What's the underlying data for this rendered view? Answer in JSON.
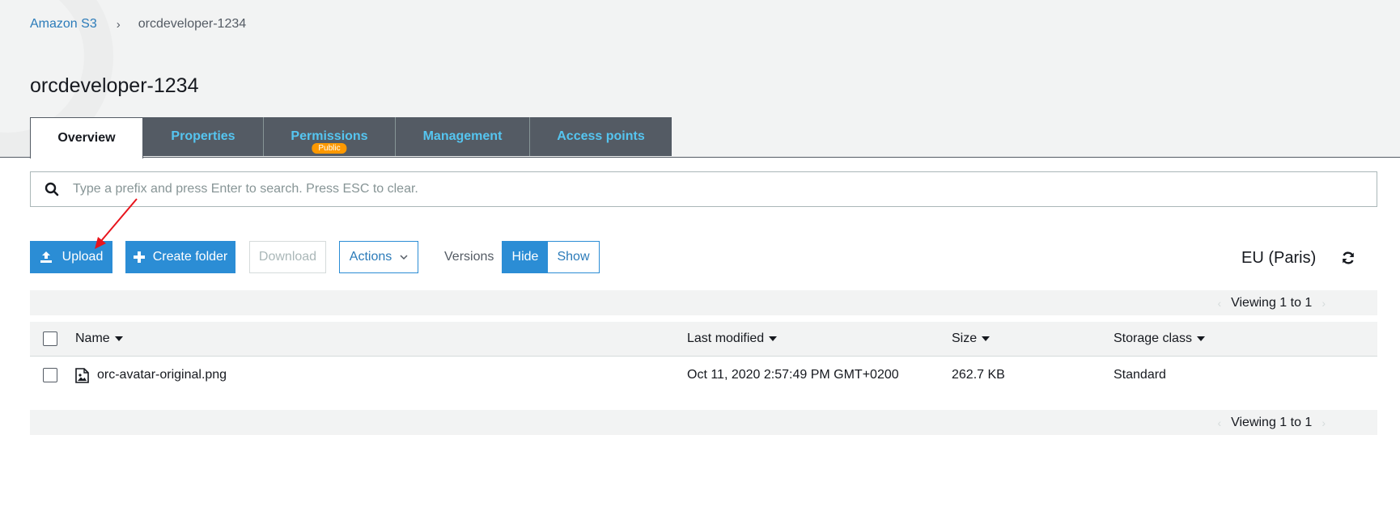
{
  "breadcrumb": {
    "root": "Amazon S3",
    "separator": "›",
    "current": "orcdeveloper-1234"
  },
  "page": {
    "title": "orcdeveloper-1234"
  },
  "tabs": [
    {
      "label": "Overview",
      "active": true
    },
    {
      "label": "Properties"
    },
    {
      "label": "Permissions",
      "badge": "Public"
    },
    {
      "label": "Management"
    },
    {
      "label": "Access points"
    }
  ],
  "search": {
    "placeholder": "Type a prefix and press Enter to search. Press ESC to clear.",
    "value": ""
  },
  "toolbar": {
    "upload": "Upload",
    "create_folder": "Create folder",
    "download": "Download",
    "actions": "Actions",
    "versions_label": "Versions",
    "hide": "Hide",
    "show": "Show",
    "region": "EU (Paris)"
  },
  "pager": {
    "text": "Viewing 1 to 1"
  },
  "table": {
    "columns": [
      "Name",
      "Last modified",
      "Size",
      "Storage class"
    ],
    "rows": [
      {
        "name": "orc-avatar-original.png",
        "last_modified": "Oct 11, 2020 2:57:49 PM GMT+0200",
        "size": "262.7 KB",
        "storage_class": "Standard"
      }
    ]
  },
  "colors": {
    "accent": "#2b8dd5",
    "tab_bg": "#545b64",
    "tab_text": "#55c5f0",
    "badge": "#ff9900",
    "annotation_arrow": "#e8141c"
  }
}
